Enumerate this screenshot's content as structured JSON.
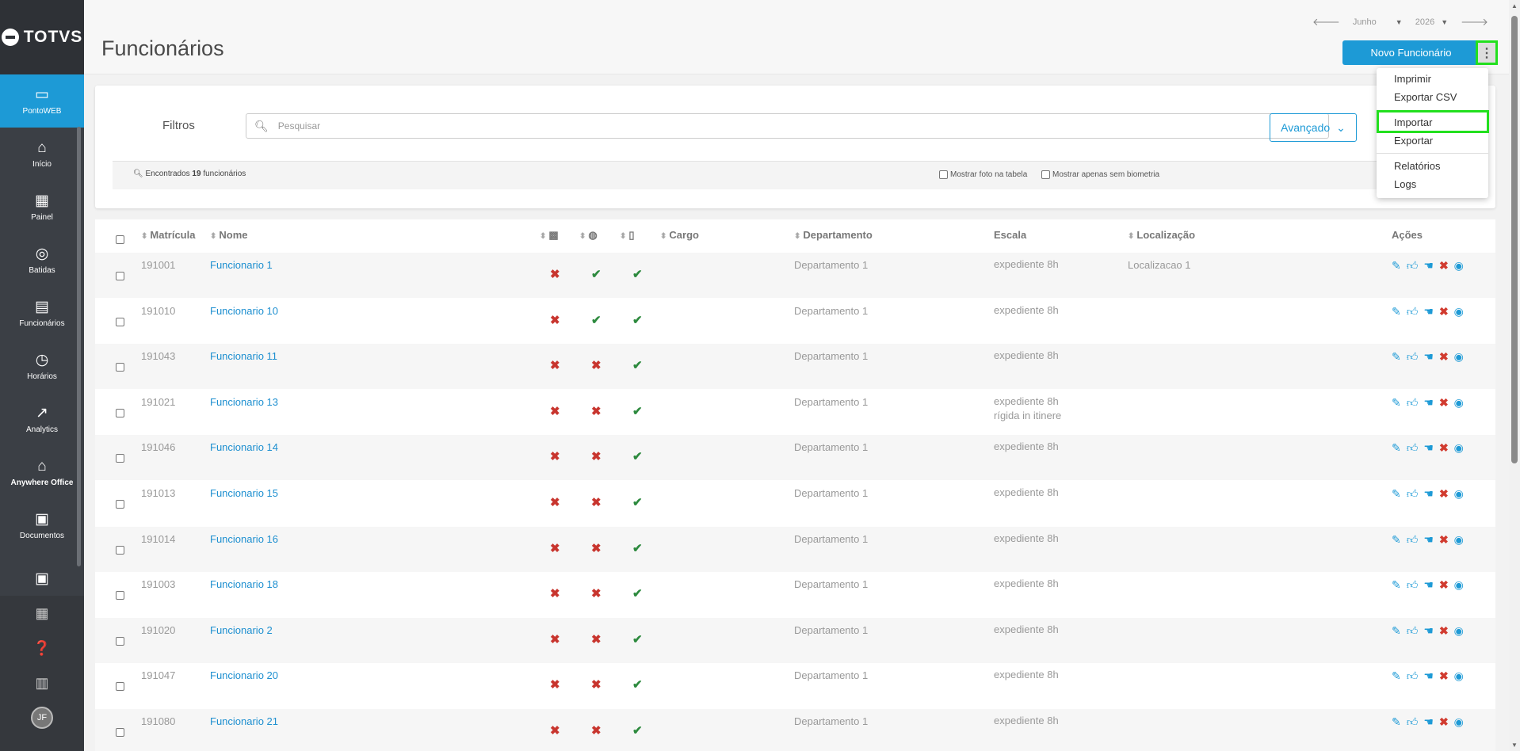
{
  "brand": {
    "logo_text": "TOTVS"
  },
  "sidebar": {
    "items": [
      {
        "label": "PontoWEB",
        "icon": "monitor-icon"
      },
      {
        "label": "Início",
        "icon": "home-icon"
      },
      {
        "label": "Painel",
        "icon": "dashboard-icon"
      },
      {
        "label": "Batidas",
        "icon": "fingerprint-icon"
      },
      {
        "label": "Funcionários",
        "icon": "badge-icon"
      },
      {
        "label": "Horários",
        "icon": "clock-icon"
      },
      {
        "label": "Analytics",
        "icon": "trend-icon"
      },
      {
        "label": "Anywhere Office",
        "icon": "home-office-icon"
      },
      {
        "label": "Documentos",
        "icon": "document-icon"
      }
    ],
    "avatar_initials": "JF"
  },
  "header": {
    "title": "Funcionários",
    "month": "Junho",
    "year": "2026",
    "new_button": "Novo Funcionário"
  },
  "menu": {
    "items": [
      "Imprimir",
      "Exportar CSV",
      "Importar",
      "Exportar",
      "Relatórios",
      "Logs"
    ],
    "highlighted": "Importar"
  },
  "filters": {
    "label": "Filtros",
    "search_placeholder": "Pesquisar",
    "advanced_label": "Avançado",
    "found_prefix": "Encontrados",
    "found_count": "19",
    "found_suffix": "funcionários",
    "opt_photo": "Mostrar foto na tabela",
    "opt_biometry": "Mostrar apenas sem biometria"
  },
  "table": {
    "columns": {
      "matricula": "Matrícula",
      "nome": "Nome",
      "cargo": "Cargo",
      "departamento": "Departamento",
      "escala": "Escala",
      "localizacao": "Localização",
      "acoes": "Ações"
    },
    "rows": [
      {
        "matricula": "191001",
        "nome": "Funcionario 1",
        "c1": false,
        "c2": true,
        "c3": true,
        "departamento": "Departamento 1",
        "escala": "expediente 8h",
        "escala2": "",
        "localizacao": "Localizacao 1"
      },
      {
        "matricula": "191010",
        "nome": "Funcionario 10",
        "c1": false,
        "c2": true,
        "c3": true,
        "departamento": "Departamento 1",
        "escala": "expediente 8h",
        "escala2": "",
        "localizacao": ""
      },
      {
        "matricula": "191043",
        "nome": "Funcionario 11",
        "c1": false,
        "c2": false,
        "c3": true,
        "departamento": "Departamento 1",
        "escala": "expediente 8h",
        "escala2": "",
        "localizacao": ""
      },
      {
        "matricula": "191021",
        "nome": "Funcionario 13",
        "c1": false,
        "c2": false,
        "c3": true,
        "departamento": "Departamento 1",
        "escala": "expediente 8h",
        "escala2": "rígida in itinere",
        "localizacao": ""
      },
      {
        "matricula": "191046",
        "nome": "Funcionario 14",
        "c1": false,
        "c2": false,
        "c3": true,
        "departamento": "Departamento 1",
        "escala": "expediente 8h",
        "escala2": "",
        "localizacao": ""
      },
      {
        "matricula": "191013",
        "nome": "Funcionario 15",
        "c1": false,
        "c2": false,
        "c3": true,
        "departamento": "Departamento 1",
        "escala": "expediente 8h",
        "escala2": "",
        "localizacao": ""
      },
      {
        "matricula": "191014",
        "nome": "Funcionario 16",
        "c1": false,
        "c2": false,
        "c3": true,
        "departamento": "Departamento 1",
        "escala": "expediente 8h",
        "escala2": "",
        "localizacao": ""
      },
      {
        "matricula": "191003",
        "nome": "Funcionario 18",
        "c1": false,
        "c2": false,
        "c3": true,
        "departamento": "Departamento 1",
        "escala": "expediente 8h",
        "escala2": "",
        "localizacao": ""
      },
      {
        "matricula": "191020",
        "nome": "Funcionario 2",
        "c1": false,
        "c2": false,
        "c3": true,
        "departamento": "Departamento 1",
        "escala": "expediente 8h",
        "escala2": "",
        "localizacao": ""
      },
      {
        "matricula": "191047",
        "nome": "Funcionario 20",
        "c1": false,
        "c2": false,
        "c3": true,
        "departamento": "Departamento 1",
        "escala": "expediente 8h",
        "escala2": "",
        "localizacao": ""
      },
      {
        "matricula": "191080",
        "nome": "Funcionario 21",
        "c1": false,
        "c2": false,
        "c3": true,
        "departamento": "Departamento 1",
        "escala": "expediente 8h",
        "escala2": "",
        "localizacao": ""
      }
    ]
  },
  "colors": {
    "accent": "#1d9ad6",
    "sidebar": "#3b3f45",
    "error": "#c8352e",
    "success": "#2d8a3e",
    "highlight": "#22e01e"
  }
}
